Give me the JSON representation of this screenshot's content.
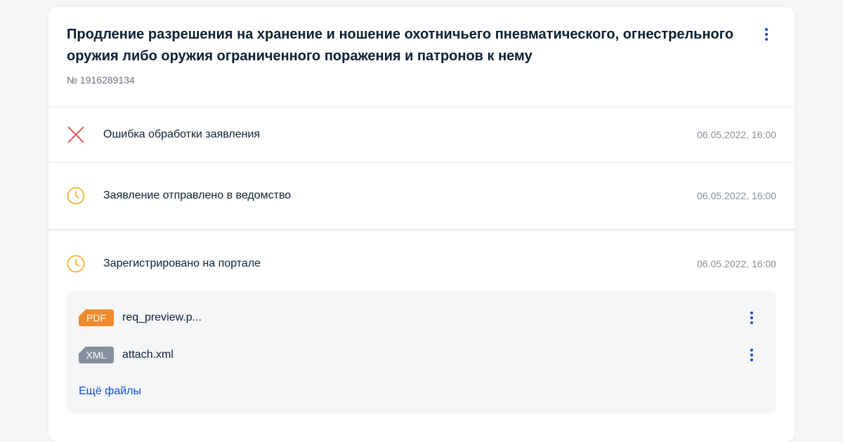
{
  "card": {
    "title": "Продление разрешения на хранение и ношение охотничьего пневматического, огнестрельного оружия либо оружия ограниченного поражения и патронов к нему",
    "number": "№ 1916289134",
    "menu_icon": "kebab-vertical-icon"
  },
  "statuses": [
    {
      "text": "Ошибка обработки заявления",
      "date": "06.05.2022, 16:00",
      "icon": "error-cross-icon",
      "color": "#e5484d"
    },
    {
      "text": "Заявление отправлено в ведомство",
      "date": "06.05.2022, 16:00",
      "icon": "clock-icon",
      "color": "#f5b12d"
    },
    {
      "text": "Зарегистрировано на портале",
      "date": "06.05.2022, 16:00",
      "icon": "clock-icon",
      "color": "#f5b12d"
    }
  ],
  "files": [
    {
      "type": "PDF",
      "name": "req_preview.p...",
      "badge_color": "#ef8b2e"
    },
    {
      "type": "XML",
      "name": "attach.xml",
      "badge_color": "#86909c"
    }
  ],
  "more_files_label": "Ещё файлы",
  "colors": {
    "accent": "#0d4cd3",
    "text": "#0b1f33",
    "muted": "#86909c",
    "background": "#f5f6f8"
  }
}
